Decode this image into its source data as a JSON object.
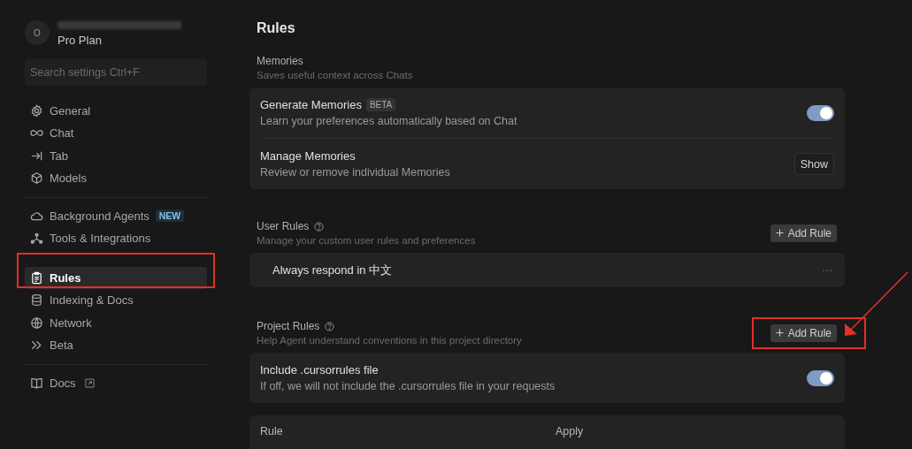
{
  "sidebar": {
    "avatar": "O",
    "plan": "Pro Plan",
    "search": {
      "placeholder": "Search settings Ctrl+F"
    },
    "groups": [
      [
        {
          "label": "General",
          "selected": false
        },
        {
          "label": "Chat",
          "selected": false
        },
        {
          "label": "Tab",
          "selected": false
        },
        {
          "label": "Models",
          "selected": false
        }
      ],
      [
        {
          "label": "Background Agents",
          "badge": "NEW",
          "selected": false
        },
        {
          "label": "Tools & Integrations",
          "selected": false
        },
        {
          "label": "Rules",
          "selected": true
        },
        {
          "label": "Indexing & Docs",
          "selected": false
        },
        {
          "label": "Network",
          "selected": false
        },
        {
          "label": "Beta",
          "selected": false
        }
      ],
      [
        {
          "label": "Docs",
          "external": true,
          "selected": false
        }
      ]
    ]
  },
  "page": {
    "title": "Rules",
    "sections": [
      {
        "title": "Memories",
        "description": "Saves useful context across Chats",
        "rows": [
          {
            "kind": "toggle",
            "title": "Generate Memories",
            "badge": "BETA",
            "description": "Learn your preferences automatically based on Chat",
            "on": true
          },
          {
            "kind": "button",
            "title": "Manage Memories",
            "description": "Review or remove individual Memories",
            "button": "Show"
          }
        ]
      },
      {
        "title": "User Rules",
        "help": true,
        "description": "Manage your custom user rules and preferences",
        "add_button": "Add Rule",
        "rules": [
          "Always respond in 中文"
        ]
      },
      {
        "title": "Project Rules",
        "help": true,
        "description": "Help Agent understand conventions in this project directory",
        "add_button": "Add Rule",
        "rows": [
          {
            "kind": "toggle",
            "title": "Include .cursorrules file",
            "description": "If off, we will not include the .cursorrules file in your requests",
            "on": true
          }
        ],
        "table": {
          "columns": [
            "Rule",
            "Apply"
          ]
        }
      }
    ]
  }
}
